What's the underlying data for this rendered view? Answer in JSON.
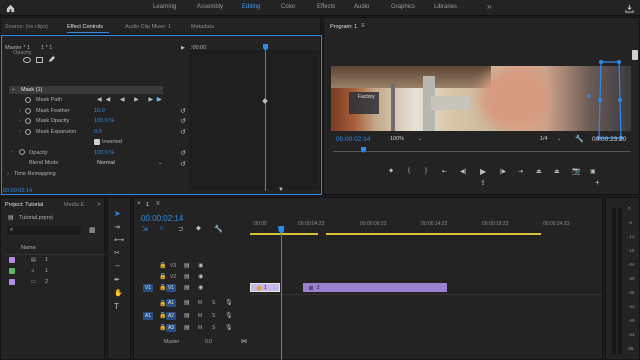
{
  "workspaces": {
    "learning": "Learning",
    "assembly": "Assembly",
    "editing": "Editing",
    "color": "Color",
    "effects": "Effects",
    "audio": "Audio",
    "graphics": "Graphics",
    "libraries": "Libraries",
    "more": "»"
  },
  "source_panel": {
    "tabs": [
      "Source: (no clips)",
      "Effect Controls",
      "Audio Clip Mixer: 1",
      "Metadata"
    ],
    "active_tab": "Effect Controls",
    "master_label": "Master * 1",
    "clip_label": "1 * 1",
    "timeline_time": ":00:00",
    "rows": {
      "opacity_partial": "Opacity",
      "mask_name": "Mask (1)",
      "mask_path": "Mask Path",
      "mask_feather": "Mask Feather",
      "mask_feather_val": "10.0",
      "mask_opacity": "Mask Opacity",
      "mask_opacity_val": "100.0 %",
      "mask_expansion": "Mask Expansion",
      "mask_expansion_val": "0.0",
      "inverted": "Inverted",
      "opacity": "Opacity",
      "opacity_val": "100.0 %",
      "blend_mode": "Blend Mode",
      "blend_mode_val": "Normal",
      "time_remapping": "Time Remapping",
      "keyframe_val": "0"
    },
    "timecode": "00:00:02:14"
  },
  "program_panel": {
    "title": "Program: 1",
    "timecode": "00:00:02:14",
    "zoom": "100%",
    "resolution": "1/4",
    "duration": "00:00:23:20",
    "video_text": "Factory"
  },
  "project_panel": {
    "tabs": [
      "Project: Tutorial",
      "Media E"
    ],
    "more": "»",
    "file": "Tutorial.prproj",
    "search_placeholder": "",
    "column_name": "Name",
    "items": [
      {
        "name": "1",
        "color": "#b48ce6"
      },
      {
        "name": "1",
        "color": "#5fb85f"
      },
      {
        "name": "2",
        "color": "#b48ce6"
      }
    ]
  },
  "timeline": {
    "tab": "1",
    "timecode": "00:00:02:14",
    "ruler": [
      ":00:00",
      "00:00:04:23",
      "00:00:09:23",
      "00:00:14:23",
      "00:00:19:23",
      "00:00:24:23"
    ],
    "video_tracks": [
      "V3",
      "V2",
      "V1"
    ],
    "audio_tracks": [
      "A1",
      "A2",
      "A3"
    ],
    "source_v": "V1",
    "source_a": "A1",
    "master_label": "Master",
    "master_val": "0.0",
    "clips": [
      {
        "label": "1",
        "start": 0.0,
        "end": 2.5
      },
      {
        "label": "2",
        "start": 4.35,
        "end": 16.2
      }
    ],
    "playhead_seconds": 2.58,
    "toggle_labels": {
      "m": "M",
      "s": "S"
    }
  },
  "meter": {
    "scale": [
      "0",
      "-6",
      "-12",
      "-18",
      "-24",
      "-30",
      "-36",
      "-42",
      "-48",
      "-54",
      "dB"
    ]
  },
  "colors": {
    "accent": "#2d8ceb",
    "clip": "#9b7fd1",
    "clip_selected": "#c8b8ea",
    "playhead": "#2d8ceb"
  }
}
